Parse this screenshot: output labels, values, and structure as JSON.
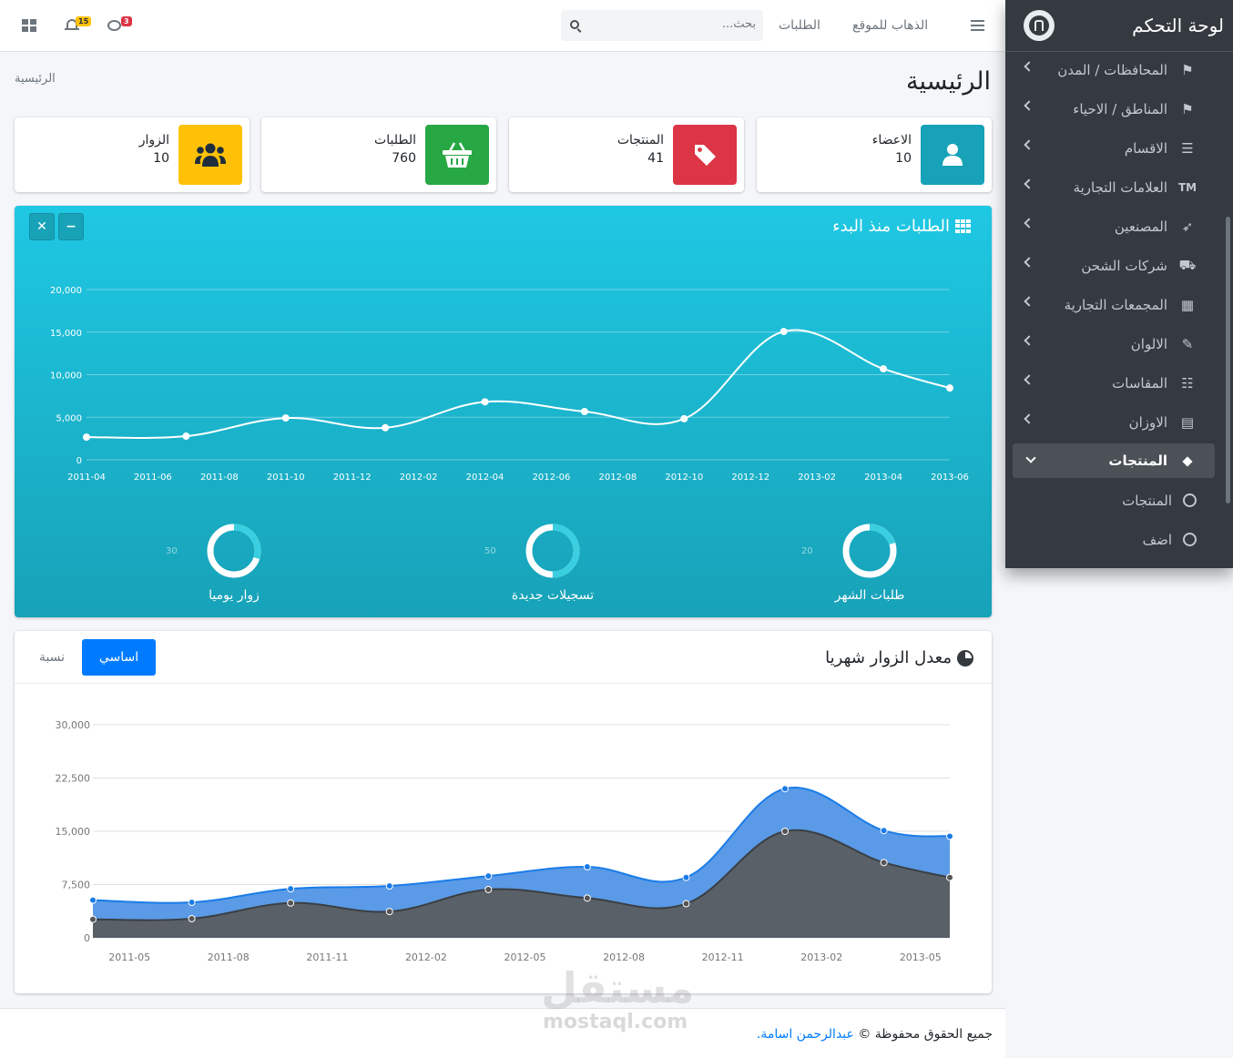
{
  "sidebar": {
    "brand": "لوحة التحكم",
    "items": [
      {
        "label": "المحافظات / المدن",
        "icon": "flag-checkered-icon"
      },
      {
        "label": "المناطق / الاحياء",
        "icon": "flag-icon"
      },
      {
        "label": "الاقسام",
        "icon": "list-icon"
      },
      {
        "label": "العلامات التجارية",
        "icon": "trademark-icon"
      },
      {
        "label": "المصنعين",
        "icon": "rocket-icon"
      },
      {
        "label": "شركات الشحن",
        "icon": "truck-icon"
      },
      {
        "label": "المجمعات التجارية",
        "icon": "building-icon"
      },
      {
        "label": "الالوان",
        "icon": "paint-brush-icon"
      },
      {
        "label": "المقاسات",
        "icon": "sliders-icon"
      },
      {
        "label": "الاوزان",
        "icon": "archive-icon"
      },
      {
        "label": "المنتجات",
        "icon": "tag-icon"
      }
    ],
    "subitems": [
      {
        "label": "المنتجات"
      },
      {
        "label": "اضف"
      }
    ]
  },
  "topbar": {
    "menu_icon": "bars-icon",
    "home_link": "الذهاب للموقع",
    "orders_link": "الطلبات",
    "search_placeholder": "بحث...",
    "notifications_count": "15",
    "messages_count": "3"
  },
  "page": {
    "title": "الرئيسية",
    "breadcrumb": "الرئيسية"
  },
  "info_boxes": [
    {
      "label": "الاعضاء",
      "value": "10",
      "color": "#17a2b8",
      "icon": "user-icon"
    },
    {
      "label": "المنتجات",
      "value": "41",
      "color": "#dc3545",
      "icon": "tag-icon"
    },
    {
      "label": "الطلبات",
      "value": "760",
      "color": "#28a745",
      "icon": "basket-icon"
    },
    {
      "label": "الزوار",
      "value": "10",
      "color": "#ffc107",
      "icon": "users-icon"
    }
  ],
  "orders_card": {
    "title": "الطلبات منذ البدء",
    "knobs": [
      {
        "label": "طلبات الشهر",
        "value": 20
      },
      {
        "label": "تسجيلات جديدة",
        "value": 50
      },
      {
        "label": "زوار يوميا",
        "value": 30
      }
    ]
  },
  "visitors_card": {
    "title": "معدل الزوار شهريا",
    "tab_primary": "اساسي",
    "tab_secondary": "نسبة"
  },
  "footer": {
    "text": "جميع الحقوق محفوظة ©",
    "author": "عبدالرحمن اسامة."
  },
  "watermark": {
    "arabic": "مستقل",
    "latin": "mostaql.com"
  },
  "chart_data": [
    {
      "type": "line",
      "x": [
        "2011-04",
        "2011-06",
        "2011-08",
        "2011-10",
        "2011-12",
        "2012-02",
        "2012-04",
        "2012-06",
        "2012-08",
        "2012-10",
        "2012-12",
        "2013-02",
        "2013-04",
        "2013-06"
      ],
      "ticks_y": [
        "0",
        "5,000",
        "10,000",
        "15,000",
        "20,000"
      ],
      "points_x": [
        "2011-04",
        "2011-07",
        "2011-10",
        "2012-01",
        "2012-04",
        "2012-07",
        "2012-10",
        "2013-01",
        "2013-04",
        "2013-06"
      ],
      "values": [
        2666,
        2778,
        4912,
        3767,
        6810,
        5670,
        4820,
        15073,
        10687,
        8432
      ],
      "ylim": [
        0,
        20000
      ],
      "grid": true
    },
    {
      "type": "area",
      "x": [
        "2011-05",
        "2011-08",
        "2011-11",
        "2012-02",
        "2012-05",
        "2012-08",
        "2012-11",
        "2013-02",
        "2013-05"
      ],
      "ticks_y": [
        "0",
        "7,500",
        "15,000",
        "22,500",
        "30,000"
      ],
      "points_x": [
        "2011-04",
        "2011-07",
        "2011-10",
        "2012-01",
        "2012-04",
        "2012-07",
        "2012-10",
        "2013-01",
        "2013-04",
        "2013-06"
      ],
      "series": [
        {
          "values": [
            5300,
            5000,
            6900,
            7300,
            8700,
            10000,
            8500,
            21000,
            15100,
            14300
          ],
          "color": "#5a9ae6"
        },
        {
          "values": [
            2600,
            2700,
            4900,
            3700,
            6800,
            5600,
            4800,
            15000,
            10600,
            8500
          ],
          "color": "#5a6067"
        }
      ],
      "ylim": [
        0,
        30000
      ],
      "grid": true
    }
  ]
}
